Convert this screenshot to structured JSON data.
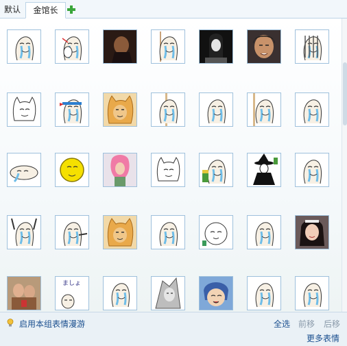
{
  "tabs": [
    {
      "label": "默认",
      "active": false
    },
    {
      "label": "金馆长",
      "active": true
    }
  ],
  "add_tab_icon": "plus-icon",
  "grid": {
    "items": [
      {
        "name": "crying-face-sticker",
        "kind": "cry"
      },
      {
        "name": "covering-mouth-sticker",
        "kind": "cover"
      },
      {
        "name": "movie-still-sticker",
        "kind": "photo-dark"
      },
      {
        "name": "pointing-face-sticker",
        "kind": "point"
      },
      {
        "name": "movie-still-sticker",
        "kind": "photo-bw"
      },
      {
        "name": "movie-still-sticker",
        "kind": "photo-face"
      },
      {
        "name": "behind-bars-sticker",
        "kind": "bars"
      },
      {
        "name": "cat-face-sticker",
        "kind": "cat"
      },
      {
        "name": "headband-face-sticker",
        "kind": "headband"
      },
      {
        "name": "gold-cat-sticker",
        "kind": "goldcat"
      },
      {
        "name": "pole-dance-sticker",
        "kind": "pole"
      },
      {
        "name": "crying-face-sticker",
        "kind": "cry"
      },
      {
        "name": "pole-face-sticker",
        "kind": "pole2"
      },
      {
        "name": "crying-face-sticker",
        "kind": "cry"
      },
      {
        "name": "lying-crying-sticker",
        "kind": "lying"
      },
      {
        "name": "yellow-moon-sticker",
        "kind": "moon"
      },
      {
        "name": "pink-hair-sticker",
        "kind": "pinkhair"
      },
      {
        "name": "cat-face-sticker",
        "kind": "cat"
      },
      {
        "name": "drinking-face-sticker",
        "kind": "drink"
      },
      {
        "name": "witch-dance-sticker",
        "kind": "witch"
      },
      {
        "name": "crying-face-sticker",
        "kind": "cry"
      },
      {
        "name": "hands-up-sticker",
        "kind": "handsup"
      },
      {
        "name": "pointing-face-sticker",
        "kind": "point2"
      },
      {
        "name": "gold-cat-sticker",
        "kind": "goldcat"
      },
      {
        "name": "crying-face-sticker",
        "kind": "cry"
      },
      {
        "name": "round-face-sticker",
        "kind": "round"
      },
      {
        "name": "crying-face-sticker",
        "kind": "cry"
      },
      {
        "name": "photo-girl-sticker",
        "kind": "photo-girl"
      },
      {
        "name": "photo-pair-sticker",
        "kind": "photo-pair"
      },
      {
        "name": "writing-face-sticker",
        "kind": "writing"
      },
      {
        "name": "crying-face-sticker",
        "kind": "cry"
      },
      {
        "name": "gray-face-sticker",
        "kind": "grayface"
      },
      {
        "name": "anime-face-sticker",
        "kind": "anime"
      },
      {
        "name": "crying-face-sticker",
        "kind": "cry"
      },
      {
        "name": "crying-face-sticker",
        "kind": "cry"
      }
    ]
  },
  "writing_text": "ましょ",
  "bottom": {
    "tour_icon": "lightbulb-icon",
    "tour_label": "启用本组表情漫游",
    "select_all": "全选",
    "move_up": "前移",
    "move_down": "后移",
    "more": "更多表情"
  },
  "colors": {
    "cell_border": "#9ec0dc",
    "link": "#1a4f8f",
    "disabled": "#8a9aaa",
    "plus_green": "#3aa63a"
  }
}
